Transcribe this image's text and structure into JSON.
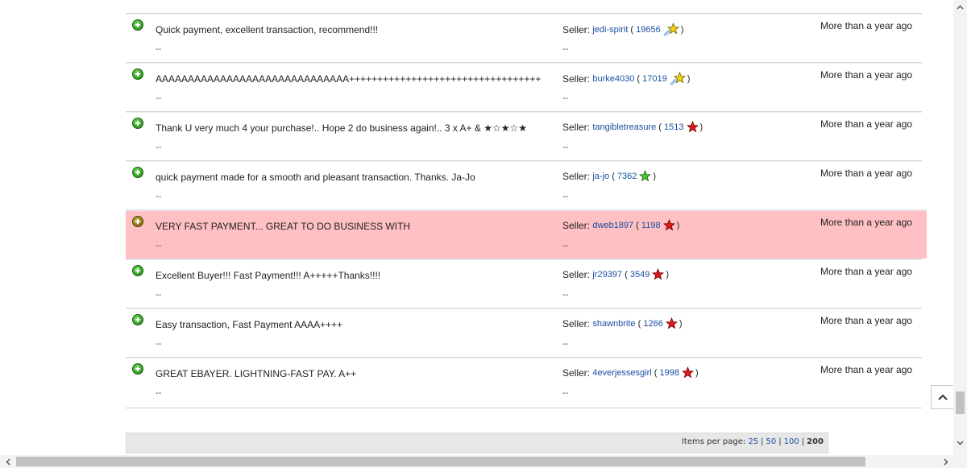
{
  "feedback": [
    {
      "comment": "Quick payment, excellent transaction, recommend!!!",
      "reply": "--",
      "seller_label": "Seller:",
      "seller": "jedi-spirit",
      "score": "19656",
      "star": "shooting-star-icon",
      "time": "More than a year ago",
      "highlighted": false
    },
    {
      "comment": "AAAAAAAAAAAAAAAAAAAAAAAAAAAAAA++++++++++++++++++++++++++++++++++",
      "reply": "--",
      "seller_label": "Seller:",
      "seller": "burke4030",
      "score": "17019",
      "star": "shooting-star-icon",
      "time": "More than a year ago",
      "highlighted": false
    },
    {
      "comment": "Thank U very much 4 your purchase!.. Hope 2 do business again!.. 3 x A+ & ★☆★☆★",
      "reply": "--",
      "seller_label": "Seller:",
      "seller": "tangibletreasure",
      "score": "1513",
      "star": "red-star-icon",
      "time": "More than a year ago",
      "highlighted": false
    },
    {
      "comment": "quick payment made for a smooth and pleasant transaction. Thanks. Ja-Jo",
      "reply": "--",
      "seller_label": "Seller:",
      "seller": "ja-jo",
      "score": "7362",
      "star": "green-star-icon",
      "time": "More than a year ago",
      "highlighted": false
    },
    {
      "comment": "VERY FAST PAYMENT... GREAT TO DO BUSINESS WITH",
      "reply": "--",
      "seller_label": "Seller:",
      "seller": "dweb1897",
      "score": "1198",
      "star": "red-star-icon",
      "time": "More than a year ago",
      "highlighted": true
    },
    {
      "comment": "Excellent Buyer!!! Fast Payment!!! A+++++Thanks!!!!",
      "reply": "--",
      "seller_label": "Seller:",
      "seller": "jr29397",
      "score": "3549",
      "star": "red-star-icon",
      "time": "More than a year ago",
      "highlighted": false
    },
    {
      "comment": "Easy transaction, Fast Payment AAAA++++",
      "reply": "--",
      "seller_label": "Seller:",
      "seller": "shawnbrite",
      "score": "1266",
      "star": "red-star-icon",
      "time": "More than a year ago",
      "highlighted": false
    },
    {
      "comment": "GREAT EBAYER. LIGHTNING-FAST PAY. A++",
      "reply": "--",
      "seller_label": "Seller:",
      "seller": "4everjessesgirl",
      "score": "1998",
      "star": "red-star-icon",
      "time": "More than a year ago",
      "highlighted": false
    }
  ],
  "pager": {
    "label": "Items per page:",
    "options": [
      "25",
      "50",
      "100"
    ],
    "current": "200"
  },
  "colors": {
    "highlight_row": "#ffc0c3",
    "link": "#1a4fa0",
    "positive_icon": "#2f9a1e"
  }
}
